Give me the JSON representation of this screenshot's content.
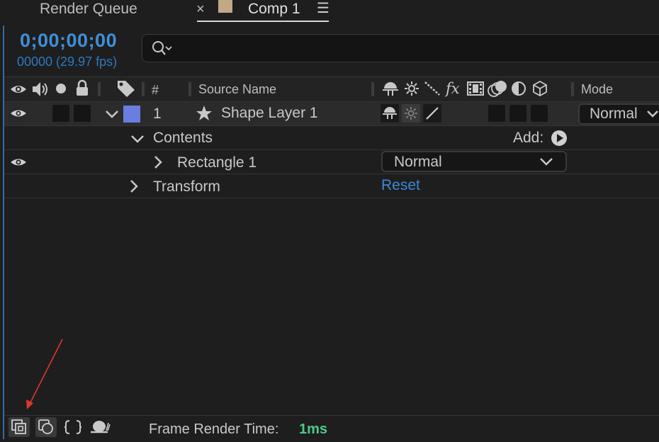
{
  "tabs": {
    "render_queue": "Render Queue",
    "comp": "Comp 1",
    "close_glyph": "×",
    "menu_glyph": "☰",
    "comp_color": "#c1a886"
  },
  "header": {
    "timecode": "0;00;00;00",
    "frames_fps": "00000 (29.97 fps)",
    "search_placeholder": ""
  },
  "columns": {
    "number": "#",
    "source_name": "Source Name",
    "mode": "Mode"
  },
  "layers": [
    {
      "number": "1",
      "name": "Shape Layer 1",
      "label_color": "#6b7de0",
      "mode": "Normal"
    }
  ],
  "contents": {
    "label": "Contents",
    "add_label": "Add:",
    "rectangle": "Rectangle 1",
    "rectangle_mode": "Normal"
  },
  "transform": {
    "label": "Transform",
    "reset": "Reset"
  },
  "footer": {
    "frame_render_label": "Frame Render Time:",
    "frame_render_value": "1ms"
  },
  "colors": {
    "accent_blue": "#3f8fd8",
    "status_green": "#4ec98a",
    "annotation_red": "#e0352b"
  }
}
